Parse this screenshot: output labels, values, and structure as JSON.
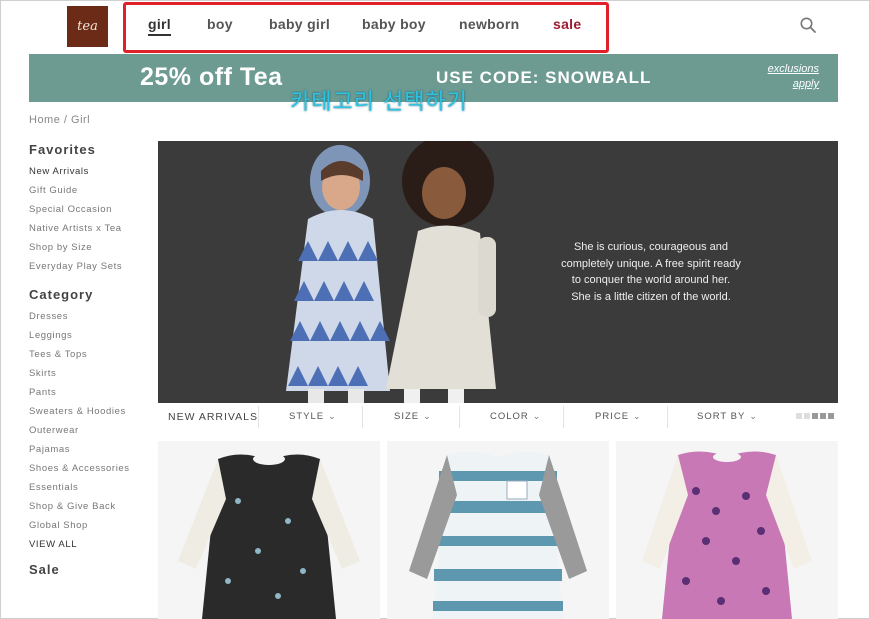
{
  "header": {
    "logo_text": "tea",
    "nav": [
      {
        "label": "girl"
      },
      {
        "label": "boy"
      },
      {
        "label": "baby girl"
      },
      {
        "label": "baby boy"
      },
      {
        "label": "newborn"
      },
      {
        "label": "sale"
      }
    ],
    "active_nav": "girl",
    "search_icon": "search-icon"
  },
  "promo": {
    "headline": "25% off Tea",
    "code_text": "USE CODE: SNOWBALL",
    "link_exclusions": "exclusions",
    "link_apply": "apply",
    "background_color": "#6d9b92"
  },
  "overlay": {
    "caption": "카테고리 선택하기",
    "highlight_color": "#e0202a"
  },
  "sidebar": {
    "breadcrumb": "Home / Girl",
    "favorites_heading": "Favorites",
    "favorites": [
      "New Arrivals",
      "Gift Guide",
      "Special Occasion",
      "Native Artists x Tea",
      "Shop by Size",
      "Everyday Play Sets"
    ],
    "category_heading": "Category",
    "categories": [
      "Dresses",
      "Leggings",
      "Tees & Tops",
      "Skirts",
      "Pants",
      "Sweaters & Hoodies",
      "Outerwear",
      "Pajamas",
      "Shoes & Accessories",
      "Essentials",
      "Shop & Give Back",
      "Global Shop",
      "VIEW ALL"
    ],
    "sale_heading": "Sale"
  },
  "hero": {
    "lines": [
      "She is curious, courageous and",
      "completely unique. A free spirit ready",
      "to conquer the world around her.",
      "She is a little citizen of the world."
    ]
  },
  "filters": {
    "title": "NEW ARRIVALS",
    "options": [
      "STYLE",
      "SIZE",
      "COLOR",
      "PRICE",
      "SORT BY"
    ]
  },
  "products": [
    {
      "name": "black space-print dress"
    },
    {
      "name": "blue tie-dye stripe dress"
    },
    {
      "name": "pink floral print dress"
    }
  ]
}
